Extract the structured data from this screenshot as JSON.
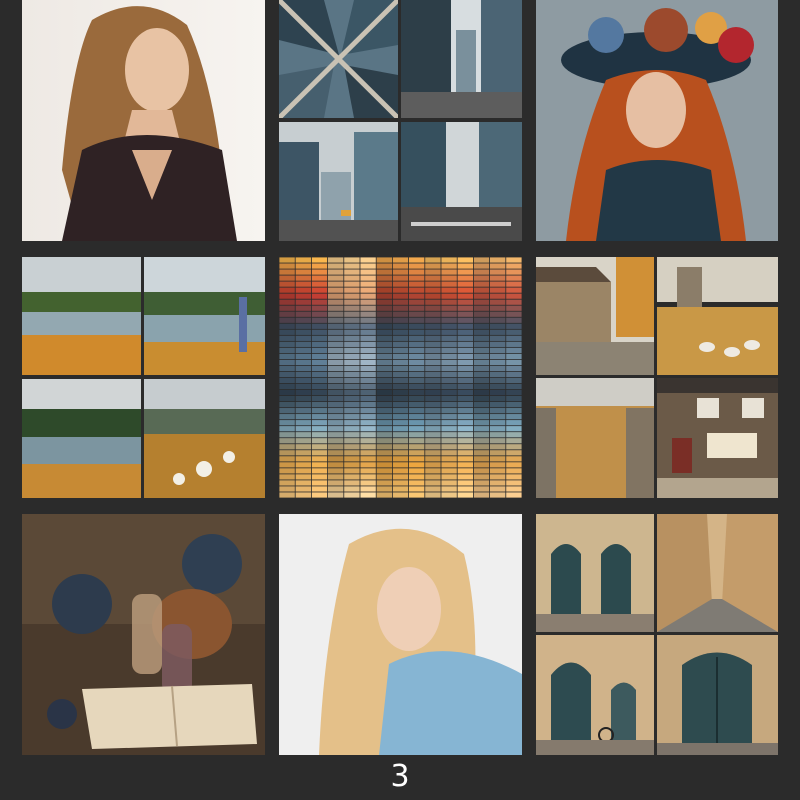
{
  "page": {
    "page_number": "3",
    "background_color": "#2b2b2b"
  },
  "palette": {
    "swatch_rows": 40,
    "columns": [
      {
        "stops": [
          "#f0b04a",
          "#c53b2e",
          "#3a4b5e",
          "#5e7d95",
          "#2f3e4d",
          "#7fa8bd",
          "#e7a84a",
          "#f2c27a"
        ]
      },
      {
        "stops": [
          "#f1c98a",
          "#e3a070",
          "#5a6e82",
          "#9fb3c2",
          "#46596b",
          "#8fb2c5",
          "#d89a40",
          "#f5d6a0"
        ]
      },
      {
        "stops": [
          "#e9a24a",
          "#b2402c",
          "#35485a",
          "#6d8aa0",
          "#2c3a47",
          "#6f9db6",
          "#e39c37",
          "#f0bf6f"
        ]
      },
      {
        "stops": [
          "#f3b95d",
          "#d24c30",
          "#41546a",
          "#7e98ad",
          "#334455",
          "#87b0c6",
          "#eaa84b",
          "#f7cf8c"
        ]
      },
      {
        "stops": [
          "#eab067",
          "#c8503a",
          "#3d5063",
          "#7592a7",
          "#2e3d4c",
          "#7ca7bd",
          "#dfa04a",
          "#f2c68a"
        ]
      }
    ]
  }
}
